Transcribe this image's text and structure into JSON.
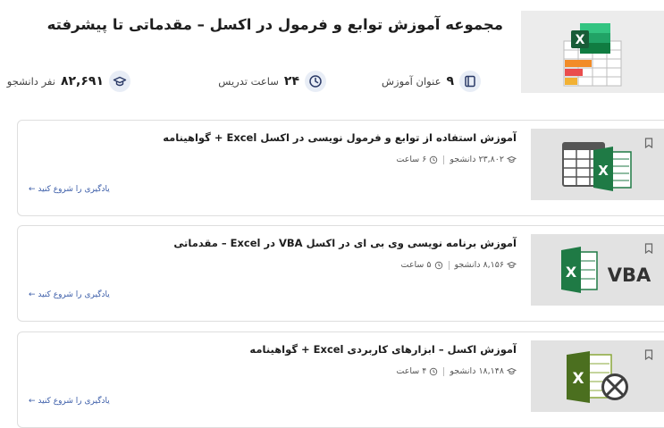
{
  "collection": {
    "title": "مجموعه آموزش توابع و فرمول در اکسل – مقدماتی تا پیشرفته",
    "stats": {
      "courses_count": "۹",
      "courses_label": "عنوان آموزش",
      "hours_count": "۲۴",
      "hours_label": "ساعت تدریس",
      "students_count": "۸۲,۶۹۱",
      "students_label": "نفر دانشجو"
    }
  },
  "courses": [
    {
      "title": "آموزش استفاده از توابع و فرمول نویسی در اکسل Excel + گواهینامه",
      "students": "۲۳,۸۰۲ دانشجو",
      "duration": "۶ ساعت",
      "cta": "یادگیری را شروع کنید ←"
    },
    {
      "title": "آموزش برنامه نویسی وی بی ای در اکسل VBA در Excel – مقدماتی",
      "students": "۸,۱۵۶ دانشجو",
      "duration": "۵ ساعت",
      "cta": "یادگیری را شروع کنید ←",
      "thumb_text": "VBA"
    },
    {
      "title": "آموزش اکسل – ابزارهای کاربردی Excel + گواهینامه",
      "students": "۱۸,۱۴۸ دانشجو",
      "duration": "۴ ساعت",
      "cta": "یادگیری را شروع کنید ←"
    }
  ],
  "colors": {
    "excel_green": "#1f7a45",
    "accent_blue": "#3a5ca8",
    "icon_bg": "#e8edf6"
  }
}
